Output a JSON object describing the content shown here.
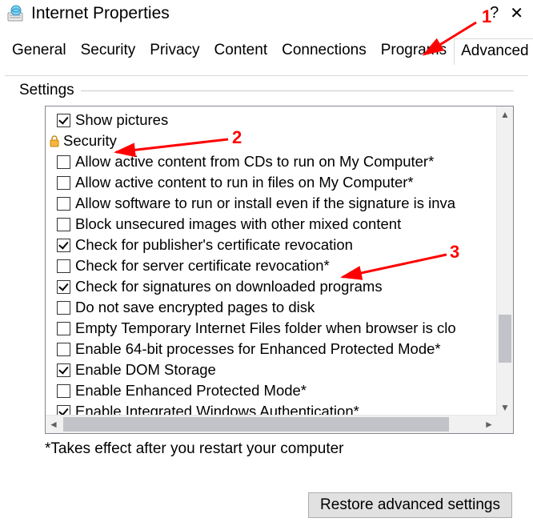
{
  "window": {
    "title": "Internet Properties",
    "help_symbol": "?",
    "close_symbol": "✕"
  },
  "tabs": [
    "General",
    "Security",
    "Privacy",
    "Content",
    "Connections",
    "Programs",
    "Advanced"
  ],
  "active_tab_index": 6,
  "section_label": "Settings",
  "tree": {
    "top_item": {
      "label": "Show pictures",
      "checked": true
    },
    "group": {
      "label": "Security"
    },
    "items": [
      {
        "label": "Allow active content from CDs to run on My Computer*",
        "checked": false
      },
      {
        "label": "Allow active content to run in files on My Computer*",
        "checked": false
      },
      {
        "label": "Allow software to run or install even if the signature is inva",
        "checked": false
      },
      {
        "label": "Block unsecured images with other mixed content",
        "checked": false
      },
      {
        "label": "Check for publisher's certificate revocation",
        "checked": true
      },
      {
        "label": "Check for server certificate revocation*",
        "checked": false
      },
      {
        "label": "Check for signatures on downloaded programs",
        "checked": true
      },
      {
        "label": "Do not save encrypted pages to disk",
        "checked": false
      },
      {
        "label": "Empty Temporary Internet Files folder when browser is clo",
        "checked": false
      },
      {
        "label": "Enable 64-bit processes for Enhanced Protected Mode*",
        "checked": false
      },
      {
        "label": "Enable DOM Storage",
        "checked": true
      },
      {
        "label": "Enable Enhanced Protected Mode*",
        "checked": false
      },
      {
        "label": "Enable Integrated Windows Authentication*",
        "checked": true
      }
    ]
  },
  "footnote": "*Takes effect after you restart your computer",
  "buttons": {
    "restore": "Restore advanced settings"
  },
  "annotations": {
    "n1": "1",
    "n2": "2",
    "n3": "3"
  }
}
